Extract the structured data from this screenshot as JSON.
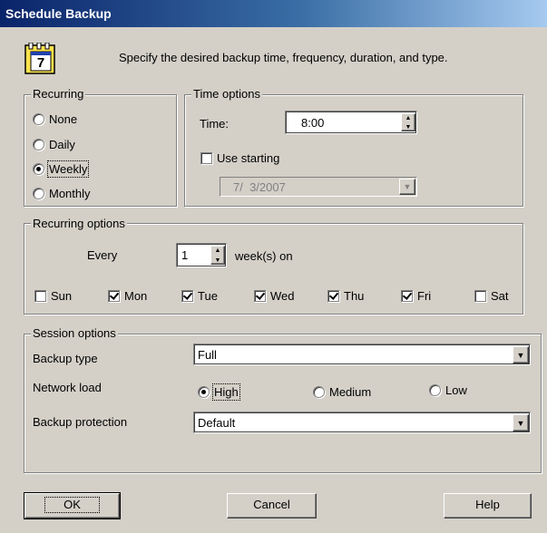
{
  "window": {
    "title": "Schedule Backup"
  },
  "header": {
    "description": "Specify the desired backup time, frequency, duration, and type.",
    "calendar_day": "7"
  },
  "recurring": {
    "legend": "Recurring",
    "options": [
      {
        "label": "None",
        "selected": false
      },
      {
        "label": "Daily",
        "selected": false
      },
      {
        "label": "Weekly",
        "selected": true
      },
      {
        "label": "Monthly",
        "selected": false
      }
    ]
  },
  "time_options": {
    "legend": "Time options",
    "time_label": "Time:",
    "time_value": "8:00",
    "use_starting_label": "Use starting",
    "use_starting_checked": false,
    "start_date": "7/  3/2007"
  },
  "recurring_options": {
    "legend": "Recurring options",
    "every_label": "Every",
    "every_value": "1",
    "unit_label": "week(s) on",
    "days": [
      {
        "label": "Sun",
        "checked": false
      },
      {
        "label": "Mon",
        "checked": true
      },
      {
        "label": "Tue",
        "checked": true
      },
      {
        "label": "Wed",
        "checked": true
      },
      {
        "label": "Thu",
        "checked": true
      },
      {
        "label": "Fri",
        "checked": true
      },
      {
        "label": "Sat",
        "checked": false
      }
    ]
  },
  "session_options": {
    "legend": "Session options",
    "backup_type_label": "Backup type",
    "backup_type_value": "Full",
    "network_load_label": "Network load",
    "network_load_options": [
      {
        "label": "High",
        "selected": true
      },
      {
        "label": "Medium",
        "selected": false
      },
      {
        "label": "Low",
        "selected": false
      }
    ],
    "backup_protection_label": "Backup protection",
    "backup_protection_value": "Default"
  },
  "buttons": {
    "ok": "OK",
    "cancel": "Cancel",
    "help": "Help"
  },
  "colors": {
    "titlebar_start": "#0a246a",
    "titlebar_end": "#a6caf0",
    "face": "#d4d0c8"
  }
}
